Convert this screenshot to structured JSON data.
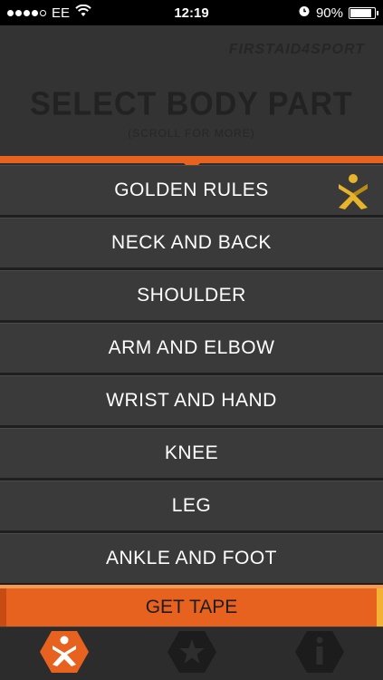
{
  "status_bar": {
    "carrier": "EE",
    "time": "12:19",
    "battery": "90%",
    "battery_level": 0.9,
    "signal_dots_filled": 4,
    "signal_dots_total": 5
  },
  "header": {
    "brand": "FIRSTAID4SPORT",
    "title": "SELECT BODY PART",
    "subtitle": "(SCROLL FOR MORE)"
  },
  "list": {
    "items": [
      {
        "label": "GOLDEN RULES",
        "icon": "figure-icon"
      },
      {
        "label": "NECK AND BACK"
      },
      {
        "label": "SHOULDER"
      },
      {
        "label": "ARM AND ELBOW"
      },
      {
        "label": "WRIST AND HAND"
      },
      {
        "label": "KNEE"
      },
      {
        "label": "LEG"
      },
      {
        "label": "ANKLE AND FOOT"
      }
    ]
  },
  "get_tape": {
    "label": "GET TAPE"
  },
  "tabs": [
    {
      "name": "body-part-tab",
      "icon": "figure-icon",
      "active": true
    },
    {
      "name": "favourites-tab",
      "icon": "star-icon",
      "active": false
    },
    {
      "name": "info-tab",
      "icon": "info-icon",
      "active": false
    }
  ],
  "colors": {
    "accent": "#e8621f",
    "gold": "#e7b52a",
    "background": "#333333"
  }
}
